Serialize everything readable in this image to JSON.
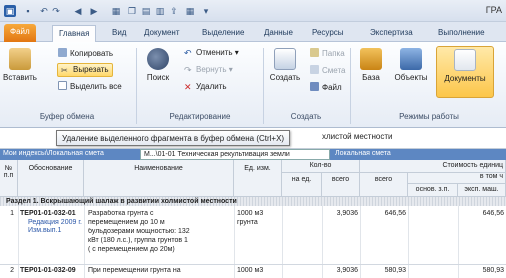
{
  "window": {
    "title_fragment": "ГРА"
  },
  "qat": {
    "icons": [
      "app-icon",
      "save-icon",
      "undo-icon",
      "redo-icon",
      "back-icon",
      "forward-icon",
      "table-icon",
      "copy-icon",
      "paste-icon",
      "print-icon",
      "export-icon",
      "grid-icon",
      "dropdown-icon"
    ]
  },
  "tabs": [
    "Файл",
    "Главная",
    "Вид",
    "Документ",
    "Выделение",
    "Данные",
    "Ресурсы",
    "Экспертиза",
    "Выполнение"
  ],
  "ribbon": {
    "clipboard": {
      "paste": "Вставить",
      "copy": "Копировать",
      "cut": "Вырезать",
      "select_all": "Выделить все",
      "label": "Буфер обмена"
    },
    "editing": {
      "search": "Поиск",
      "undo": "Отменить",
      "redo": "Вернуть",
      "delete": "Удалить",
      "label": "Редактирование"
    },
    "create": {
      "create": "Создать",
      "folder": "Папка",
      "estimate": "Смета",
      "file": "Файл",
      "label": "Создать"
    },
    "modes": {
      "base": "База",
      "objects": "Объекты",
      "documents": "Документы",
      "label": "Режимы работы"
    }
  },
  "tooltip": {
    "text": "Удаление выделенного фрагмента в буфер обмена (Ctrl+X)",
    "behind_text": "хлистой местности"
  },
  "doc_tabs": [
    "Мои индексы\\Локальная смета",
    "М...\\01-01 Техническая рекультивация земли",
    "Локальная смета"
  ],
  "columns": {
    "num": "№ п.п",
    "code": "Обоснование",
    "name": "Наименование",
    "unit": "Ед. изм.",
    "qty": "Кол-во",
    "qty_per": "на ед.",
    "qty_total": "всего",
    "cost": "Стоимость единиц",
    "cost_total": "всего",
    "cost_sub": "в том ч",
    "base_wage": "основ. з.п.",
    "machines": "эксп. маш."
  },
  "section_title": "Раздел 1. Вскрышающий шалаж в развитии холмистой местности",
  "rows": [
    {
      "num": "1",
      "code": "ТЕР01-01-032-01",
      "edition": "Редакция 2009 г.",
      "change": "Изм.вып.1",
      "name_lines": [
        "Разработка грунта с",
        "перемещением до 10 м",
        "бульдозерами мощностью: 132",
        "кВт (180 л.с.), группа грунтов 1",
        "( с перемещением до 20м)"
      ],
      "unit_lines": [
        "1000 м3",
        "грунта"
      ],
      "qty_total": "3,9036",
      "cost_total": "646,56",
      "machines": "646,56"
    },
    {
      "num": "2",
      "code": "ТЕР01-01-032-09",
      "name_lines": [
        "При перемещении грунта на"
      ],
      "unit_lines": [
        "1000 м3"
      ],
      "qty_total": "3,9036",
      "cost_total": "580,93",
      "machines": "580,93"
    }
  ]
}
